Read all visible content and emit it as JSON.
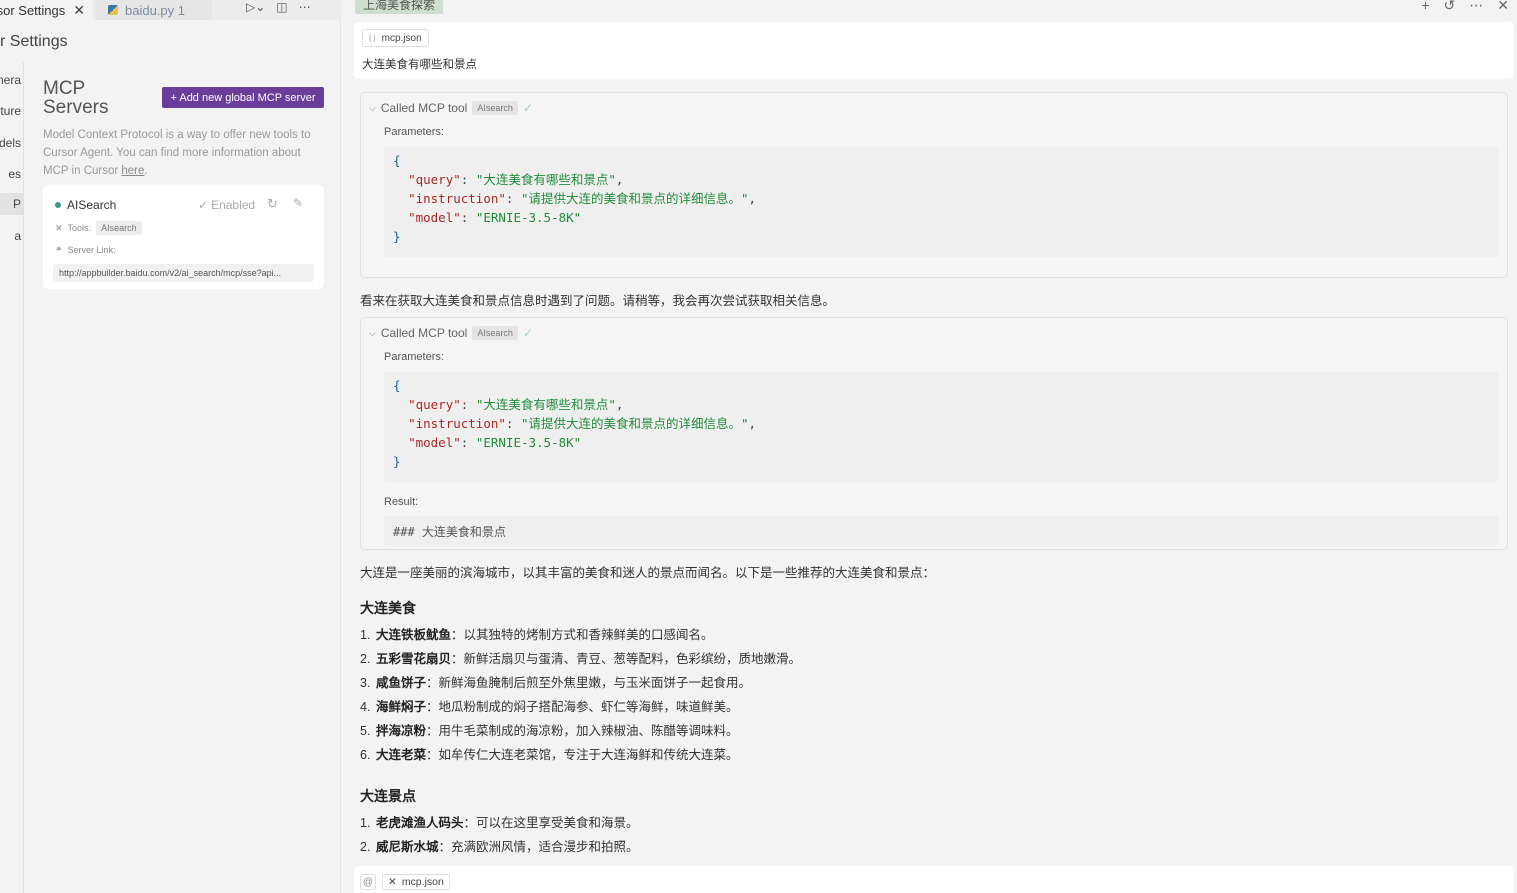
{
  "editor": {
    "tabs": [
      {
        "label": "sor Settings",
        "active": true
      },
      {
        "label": "baidu.py 1",
        "active": false
      }
    ]
  },
  "settings": {
    "title": "r Settings",
    "nav_items": [
      "nera",
      "ture",
      "dels",
      "es",
      "P",
      "a"
    ],
    "mcp": {
      "heading": "MCP Servers",
      "add_button": "+ Add new global MCP server",
      "description": "Model Context Protocol is a way to offer new tools to Cursor Agent. You can find more information about MCP in Cursor ",
      "description_link": "here",
      "description_end": ".",
      "server": {
        "name": "AISearch",
        "status": "Enabled",
        "tools_label": "Tools:",
        "tool": "AIsearch",
        "link_label": "Server Link:",
        "url": "http://appbuilder.baidu.com/v2/ai_search/mcp/sse?api..."
      }
    }
  },
  "chat": {
    "title": "上海美食探索",
    "user_message": {
      "file_chip": "mcp.json",
      "text": "大连美食有哪些和景点"
    },
    "tool_calls": [
      {
        "header": "Called MCP tool",
        "tool": "AIsearch",
        "params_label": "Parameters:",
        "query": "大连美食有哪些和景点",
        "instruction": "请提供大连的美食和景点的详细信息。",
        "model": "ERNIE-3.5-8K"
      },
      {
        "header": "Called MCP tool",
        "tool": "AIsearch",
        "params_label": "Parameters:",
        "query": "大连美食有哪些和景点",
        "instruction": "请提供大连的美食和景点的详细信息。",
        "model": "ERNIE-3.5-8K",
        "result_label": "Result:",
        "result": "### 大连美食和景点"
      }
    ],
    "retry_text": "看来在获取大连美食和景点信息时遇到了问题。请稍等，我会再次尝试获取相关信息。",
    "intro_text": "大连是一座美丽的滨海城市，以其丰富的美食和迷人的景点而闻名。以下是一些推荐的大连美食和景点：",
    "food_heading": "大连美食",
    "foods": [
      {
        "name": "大连铁板鱿鱼",
        "desc": "：以其独特的烤制方式和香辣鲜美的口感闻名。"
      },
      {
        "name": "五彩雪花扇贝",
        "desc": "：新鲜活扇贝与蛋清、青豆、葱等配料，色彩缤纷，质地嫩滑。"
      },
      {
        "name": "咸鱼饼子",
        "desc": "：新鲜海鱼腌制后煎至外焦里嫩，与玉米面饼子一起食用。"
      },
      {
        "name": "海鲜焖子",
        "desc": "：地瓜粉制成的焖子搭配海参、虾仁等海鲜，味道鲜美。"
      },
      {
        "name": "拌海凉粉",
        "desc": "：用牛毛菜制成的海凉粉，加入辣椒油、陈醋等调味料。"
      },
      {
        "name": "大连老菜",
        "desc": "：如牟传仁大连老菜馆，专注于大连海鲜和传统大连菜。"
      }
    ],
    "spots_heading": "大连景点",
    "spots": [
      {
        "name": "老虎滩渔人码头",
        "desc": "：可以在这里享受美食和海景。"
      },
      {
        "name": "威尼斯水城",
        "desc": "：充满欧洲风情，适合漫步和拍照。"
      }
    ],
    "composer": {
      "at_label": "@",
      "file_chip": "mcp.json"
    }
  }
}
